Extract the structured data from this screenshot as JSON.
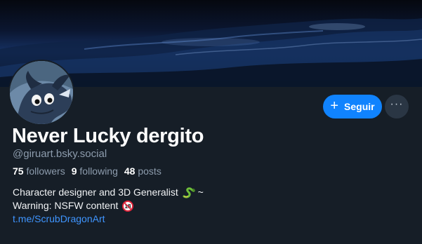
{
  "profile": {
    "display_name": "Never Lucky dergito",
    "handle": "@giruart.bsky.social",
    "followers_count": "75",
    "followers_label": "followers",
    "following_count": "9",
    "following_label": "following",
    "posts_count": "48",
    "posts_label": "posts",
    "bio_line1": "Character designer and 3D Generalist",
    "bio_line1_suffix": "~",
    "bio_line2": "Warning: NSFW content",
    "bio_link": "t.me/ScrubDragonArt"
  },
  "actions": {
    "follow_label": "Seguir",
    "more_label": "···"
  },
  "colors": {
    "background": "#161e27",
    "accent": "#1083fe",
    "link": "#3f95ff",
    "muted_text": "#8d9cad"
  },
  "icons": {
    "follow": "plus-icon",
    "more": "ellipsis-icon",
    "bio_emoji_1": "snake-emoji",
    "bio_emoji_2": "no-under-18-emoji"
  }
}
